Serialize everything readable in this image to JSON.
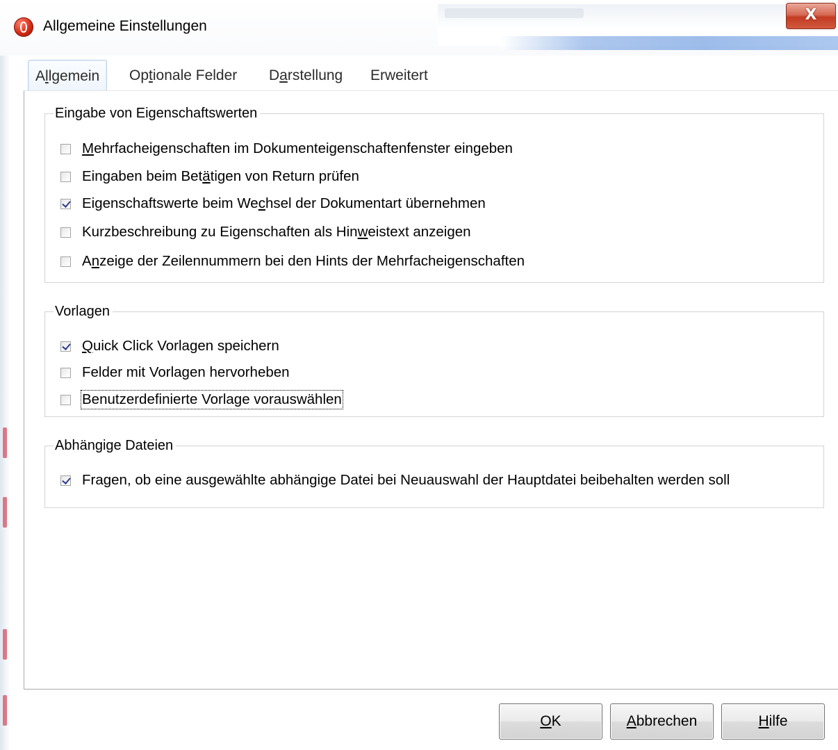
{
  "window": {
    "title": "Allgemeine Einstellungen",
    "close_glyph": "X"
  },
  "tabs": [
    {
      "label_pre": "A",
      "label_u": "l",
      "label_post": "lgemein",
      "active": true
    },
    {
      "label_pre": "Op",
      "label_u": "t",
      "label_post": "ionale Felder",
      "active": false
    },
    {
      "label_pre": "D",
      "label_u": "a",
      "label_post": "rstellung",
      "active": false
    },
    {
      "label_pre": "Erweitert",
      "label_u": "",
      "label_post": "",
      "active": false
    }
  ],
  "groups": {
    "eingabe": {
      "legend": "Eingabe von Eigenschaftswerten",
      "items": [
        {
          "pre": "",
          "u": "M",
          "post": "ehrfacheigenschaften im Dokumenteigenschaftenfenster eingeben",
          "checked": false
        },
        {
          "pre": "Eingaben beim Bet",
          "u": "ä",
          "post": "tigen von Return prüfen",
          "checked": false
        },
        {
          "pre": "Eigenschaftswerte beim We",
          "u": "c",
          "post": "hsel der Dokumentart übernehmen",
          "checked": true
        },
        {
          "pre": "Kurzbeschreibung zu Eigenschaften als Hin",
          "u": "w",
          "post": "eistext anzeigen",
          "checked": false
        },
        {
          "pre": "A",
          "u": "n",
          "post": "zeige der Zeilennummern bei den Hints der Mehrfacheigenschaften",
          "checked": false
        }
      ]
    },
    "vorlagen": {
      "legend": "Vorlagen",
      "items": [
        {
          "pre": "",
          "u": "Q",
          "post": "uick Click Vorlagen speichern",
          "checked": true
        },
        {
          "pre": "Felder mit Vorlagen hervorheben",
          "u": "",
          "post": "",
          "checked": false
        },
        {
          "pre": "Benutzerdefinierte Vorlage vorauswählen",
          "u": "",
          "post": "",
          "checked": false
        }
      ]
    },
    "abhaengig": {
      "legend": "Abhängige Dateien",
      "items": [
        {
          "pre": "Fragen, ob eine ausgewählte abhängige Datei bei Neuauswahl der Hauptdatei beibehalten werden soll",
          "u": "",
          "post": "",
          "checked": true
        }
      ]
    }
  },
  "buttons": {
    "ok": {
      "u": "O",
      "post": "K"
    },
    "cancel": {
      "u": "A",
      "post": "bbrechen"
    },
    "help": {
      "u": "H",
      "post": "ilfe"
    }
  },
  "colors": {
    "close_button": "#c43b22",
    "checkmark": "#2b3b8f",
    "tab_active_border": "#bfd3ea"
  },
  "icons": {
    "app": "app-logo-icon",
    "close": "close-icon",
    "checkbox_checked": "checkmark-icon"
  }
}
